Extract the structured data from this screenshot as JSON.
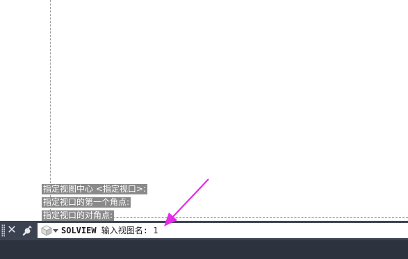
{
  "history": [
    "指定视图中心 <指定视口>:",
    "指定视口的第一个角点:",
    "指定视口的对角点:"
  ],
  "command_line": {
    "command": "SOLVIEW",
    "prompt": " 输入视图名: ",
    "value": "1"
  },
  "icons": {
    "grip": "grip-handle-icon",
    "close": "close-icon",
    "customize": "wrench-icon",
    "recent": "cube-icon",
    "dropdown": "chevron-down-icon"
  },
  "colors": {
    "annotation_arrow": "#e52be5",
    "command_bar": "#3b4250",
    "history_bg": "#8a8a8a"
  }
}
